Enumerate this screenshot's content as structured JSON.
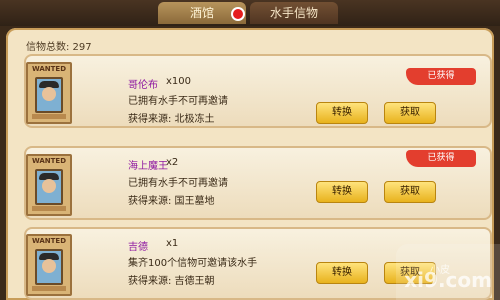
{
  "tabs": {
    "tavern": "酒馆",
    "crew_tokens": "水手信物"
  },
  "summary": {
    "total_label": "信物总数: 297"
  },
  "cards": [
    {
      "name": "哥伦布",
      "count": "x100",
      "line1": "已拥有水手不可再邀请",
      "line2": "获得来源: 北极冻土",
      "status": "已获得",
      "convert": "转换",
      "get": "获取"
    },
    {
      "name": "海上魔王",
      "count": "x2",
      "line1": "已拥有水手不可再邀请",
      "line2": "获得来源: 国王墓地",
      "status": "已获得",
      "convert": "转换",
      "get": "获取"
    },
    {
      "name": "吉德",
      "count": "x1",
      "line1": "集齐100个信物可邀请该水手",
      "line2": "获得来源: 吉德王朝",
      "status": "",
      "convert": "转换",
      "get": "获取"
    }
  ],
  "watermark": {
    "text": "xi9.com",
    "cn": "小皮"
  }
}
